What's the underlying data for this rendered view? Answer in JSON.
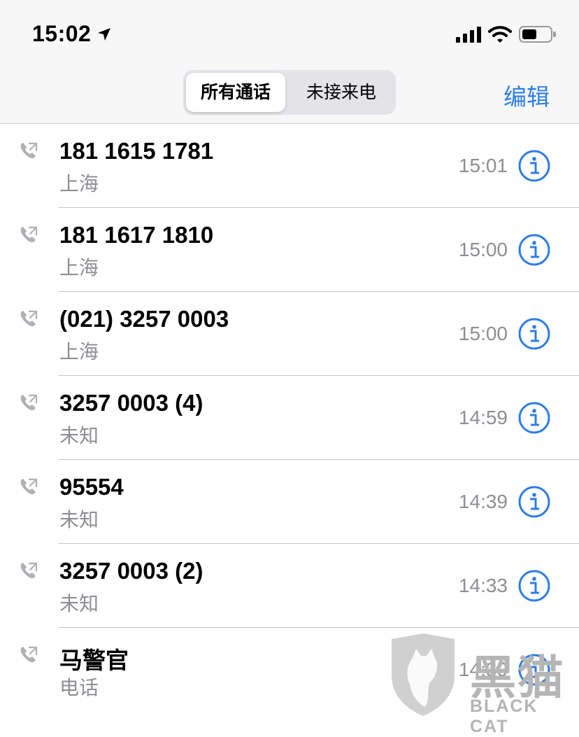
{
  "status_bar": {
    "time": "15:02",
    "icons": [
      "location-arrow-icon",
      "cellular-signal-icon",
      "wifi-icon",
      "battery-icon"
    ]
  },
  "nav": {
    "segments": [
      {
        "label": "所有通话",
        "selected": true
      },
      {
        "label": "未接来电",
        "selected": false
      }
    ],
    "edit_label": "编辑"
  },
  "colors": {
    "accent": "#2d7ee6",
    "secondary_text": "#8e8e93",
    "separator": "#c8c7cc",
    "header_bg": "#f7f7f7"
  },
  "calls": [
    {
      "name": "181 1615 1781",
      "sub": "上海",
      "time": "15:01"
    },
    {
      "name": "181 1617 1810",
      "sub": "上海",
      "time": "15:00"
    },
    {
      "name": "(021) 3257 0003",
      "sub": "上海",
      "time": "15:00"
    },
    {
      "name": "3257 0003 (4)",
      "sub": "未知",
      "time": "14:59"
    },
    {
      "name": "95554",
      "sub": "未知",
      "time": "14:39"
    },
    {
      "name": "3257 0003 (2)",
      "sub": "未知",
      "time": "14:33"
    },
    {
      "name": "马警官",
      "sub": "电话",
      "time": "14:30"
    }
  ],
  "watermark": {
    "han": "黑猫",
    "text": "BLACK CAT"
  }
}
